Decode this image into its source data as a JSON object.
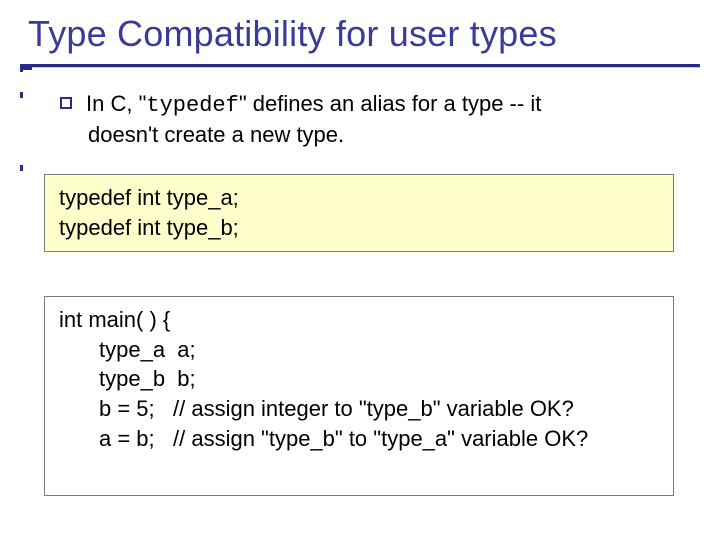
{
  "title": "Type Compatibility for user types",
  "bullet": {
    "pre": "In C, \"",
    "code": "typedef",
    "post": "\" defines an alias for a type -- it",
    "line2": "doesn't create a new type."
  },
  "code1": {
    "l1": "typedef int type_a;",
    "l2": "typedef int type_b;"
  },
  "code2": {
    "l1": "int main( ) {",
    "l2": "type_a  a;",
    "l3": "type_b  b;",
    "l4": "b = 5;   // assign integer to \"type_b\" variable OK?",
    "l5": "a = b;   // assign \"type_b\" to \"type_a\" variable OK?"
  }
}
